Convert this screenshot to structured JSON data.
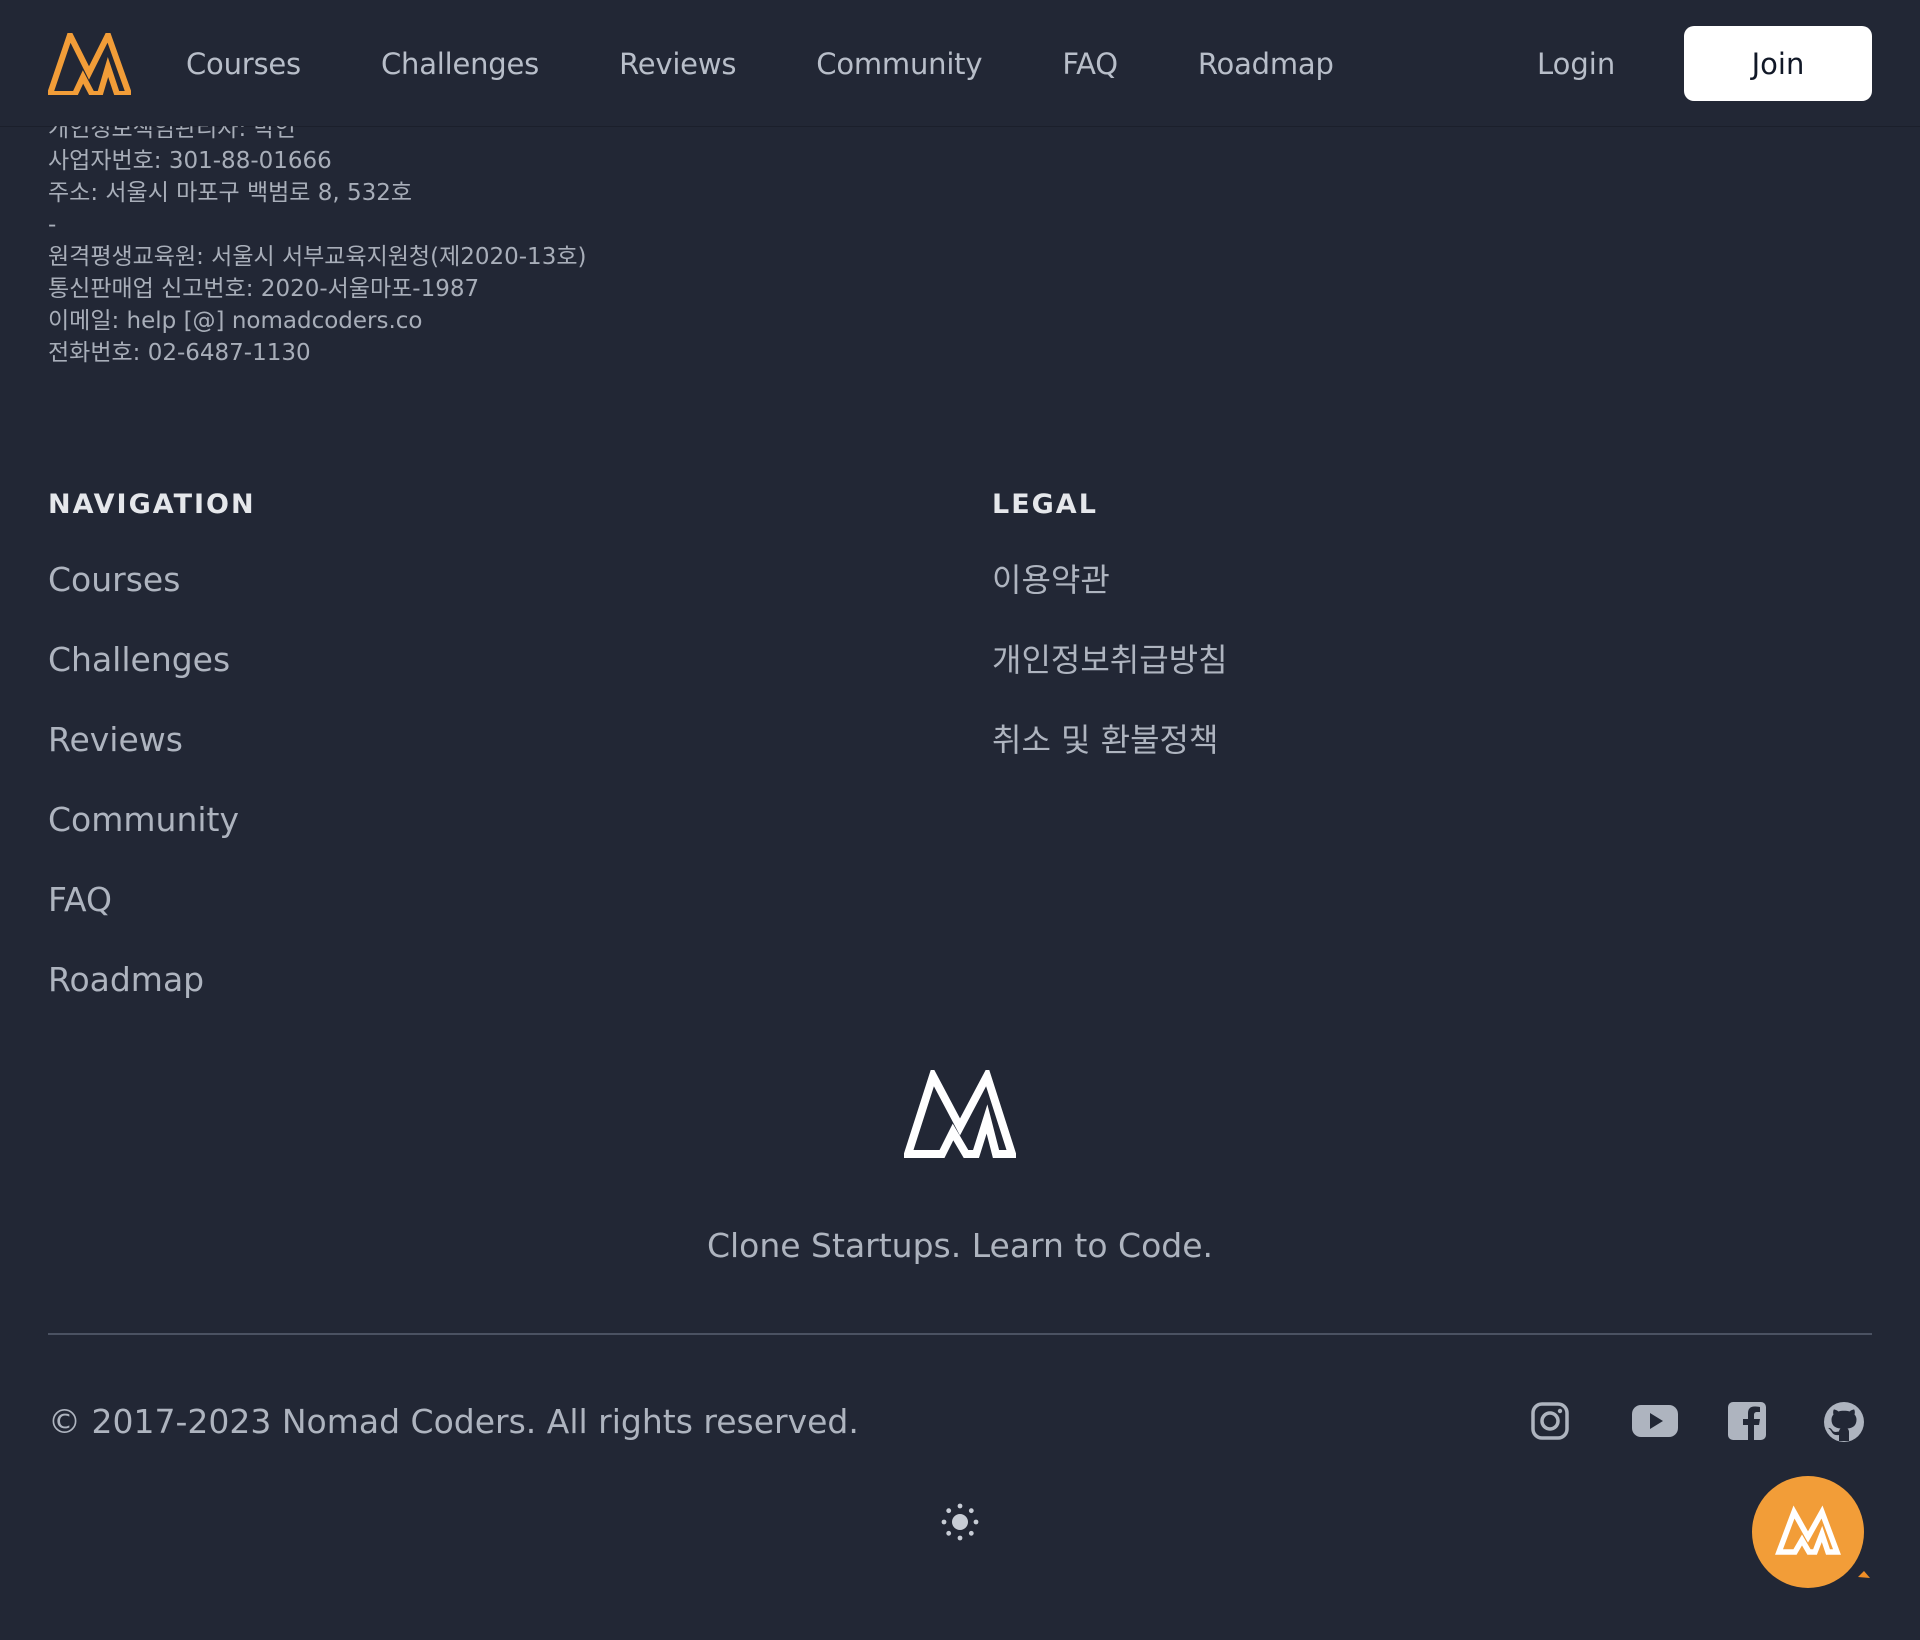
{
  "colors": {
    "background": "#222735",
    "brand_orange": "#f29d38",
    "text_muted": "#aeb4bf",
    "heading": "#e5e7eb",
    "join_bg": "#ffffff"
  },
  "header": {
    "logo_icon": "nomad-coders-logo",
    "nav": [
      "Courses",
      "Challenges",
      "Reviews",
      "Community",
      "FAQ",
      "Roadmap"
    ],
    "login_label": "Login",
    "join_label": "Join"
  },
  "company_info": [
    "개인정보책임관리자: 박인",
    "사업자번호: 301-88-01666",
    "주소: 서울시 마포구 백범로 8, 532호",
    "-",
    "원격평생교육원: 서울시 서부교육지원청(제2020-13호)",
    "통신판매업 신고번호: 2020-서울마포-1987",
    "이메일: help [@] nomadcoders.co",
    "전화번호: 02-6487-1130"
  ],
  "footer": {
    "navigation": {
      "heading": "NAVIGATION",
      "links": [
        "Courses",
        "Challenges",
        "Reviews",
        "Community",
        "FAQ",
        "Roadmap"
      ]
    },
    "legal": {
      "heading": "LEGAL",
      "links": [
        "이용약관",
        "개인정보취급방침",
        "취소 및 환불정책"
      ]
    },
    "tagline": "Clone Startups. Learn to Code.",
    "copyright": "© 2017-2023 Nomad Coders. All rights reserved.",
    "socials": [
      "instagram-icon",
      "youtube-icon",
      "facebook-icon",
      "github-icon"
    ],
    "theme_icon": "sun-icon",
    "chat_icon": "chat-bubble-logo-icon"
  }
}
